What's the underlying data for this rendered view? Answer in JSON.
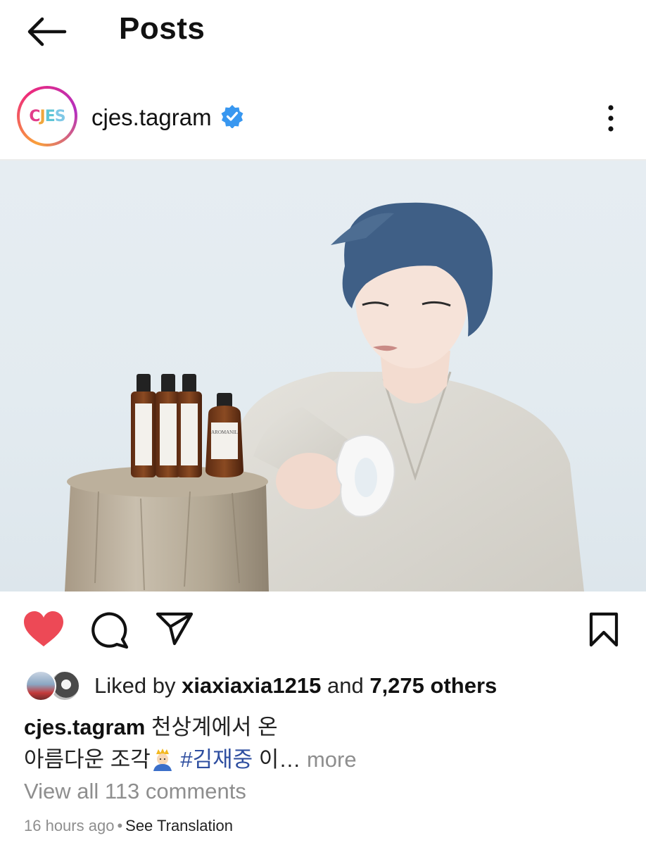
{
  "header": {
    "title": "Posts",
    "back_icon": "arrow-left-icon"
  },
  "post": {
    "avatar_logo": {
      "c": "C",
      "j": "J",
      "e": "E",
      "s": "S"
    },
    "username": "cjes.tagram",
    "verified_icon": "verified-badge-icon",
    "more_icon": "more-vertical-icon",
    "photo_label": "AROMANIL"
  },
  "actions": {
    "like_icon": "heart-filled-icon",
    "comment_icon": "comment-icon",
    "share_icon": "send-icon",
    "save_icon": "bookmark-icon",
    "liked_color": "#ed4956"
  },
  "likes": {
    "prefix": "Liked by",
    "user": "xiaxiaxia1215",
    "middle": "and",
    "others": "7,275 others"
  },
  "caption": {
    "username": "cjes.tagram",
    "line1": "천상계에서 온",
    "line2": "아름다운 조각",
    "hashtag": "#김재중",
    "tail": "이…",
    "more": "more"
  },
  "comments": {
    "view_all": "View all 113 comments"
  },
  "meta": {
    "time": "16 hours ago",
    "separator": "•",
    "translation": "See Translation"
  },
  "colors": {
    "hashtag": "#2f4fa0",
    "muted": "#8e8e8e",
    "verified": "#3897f0"
  }
}
